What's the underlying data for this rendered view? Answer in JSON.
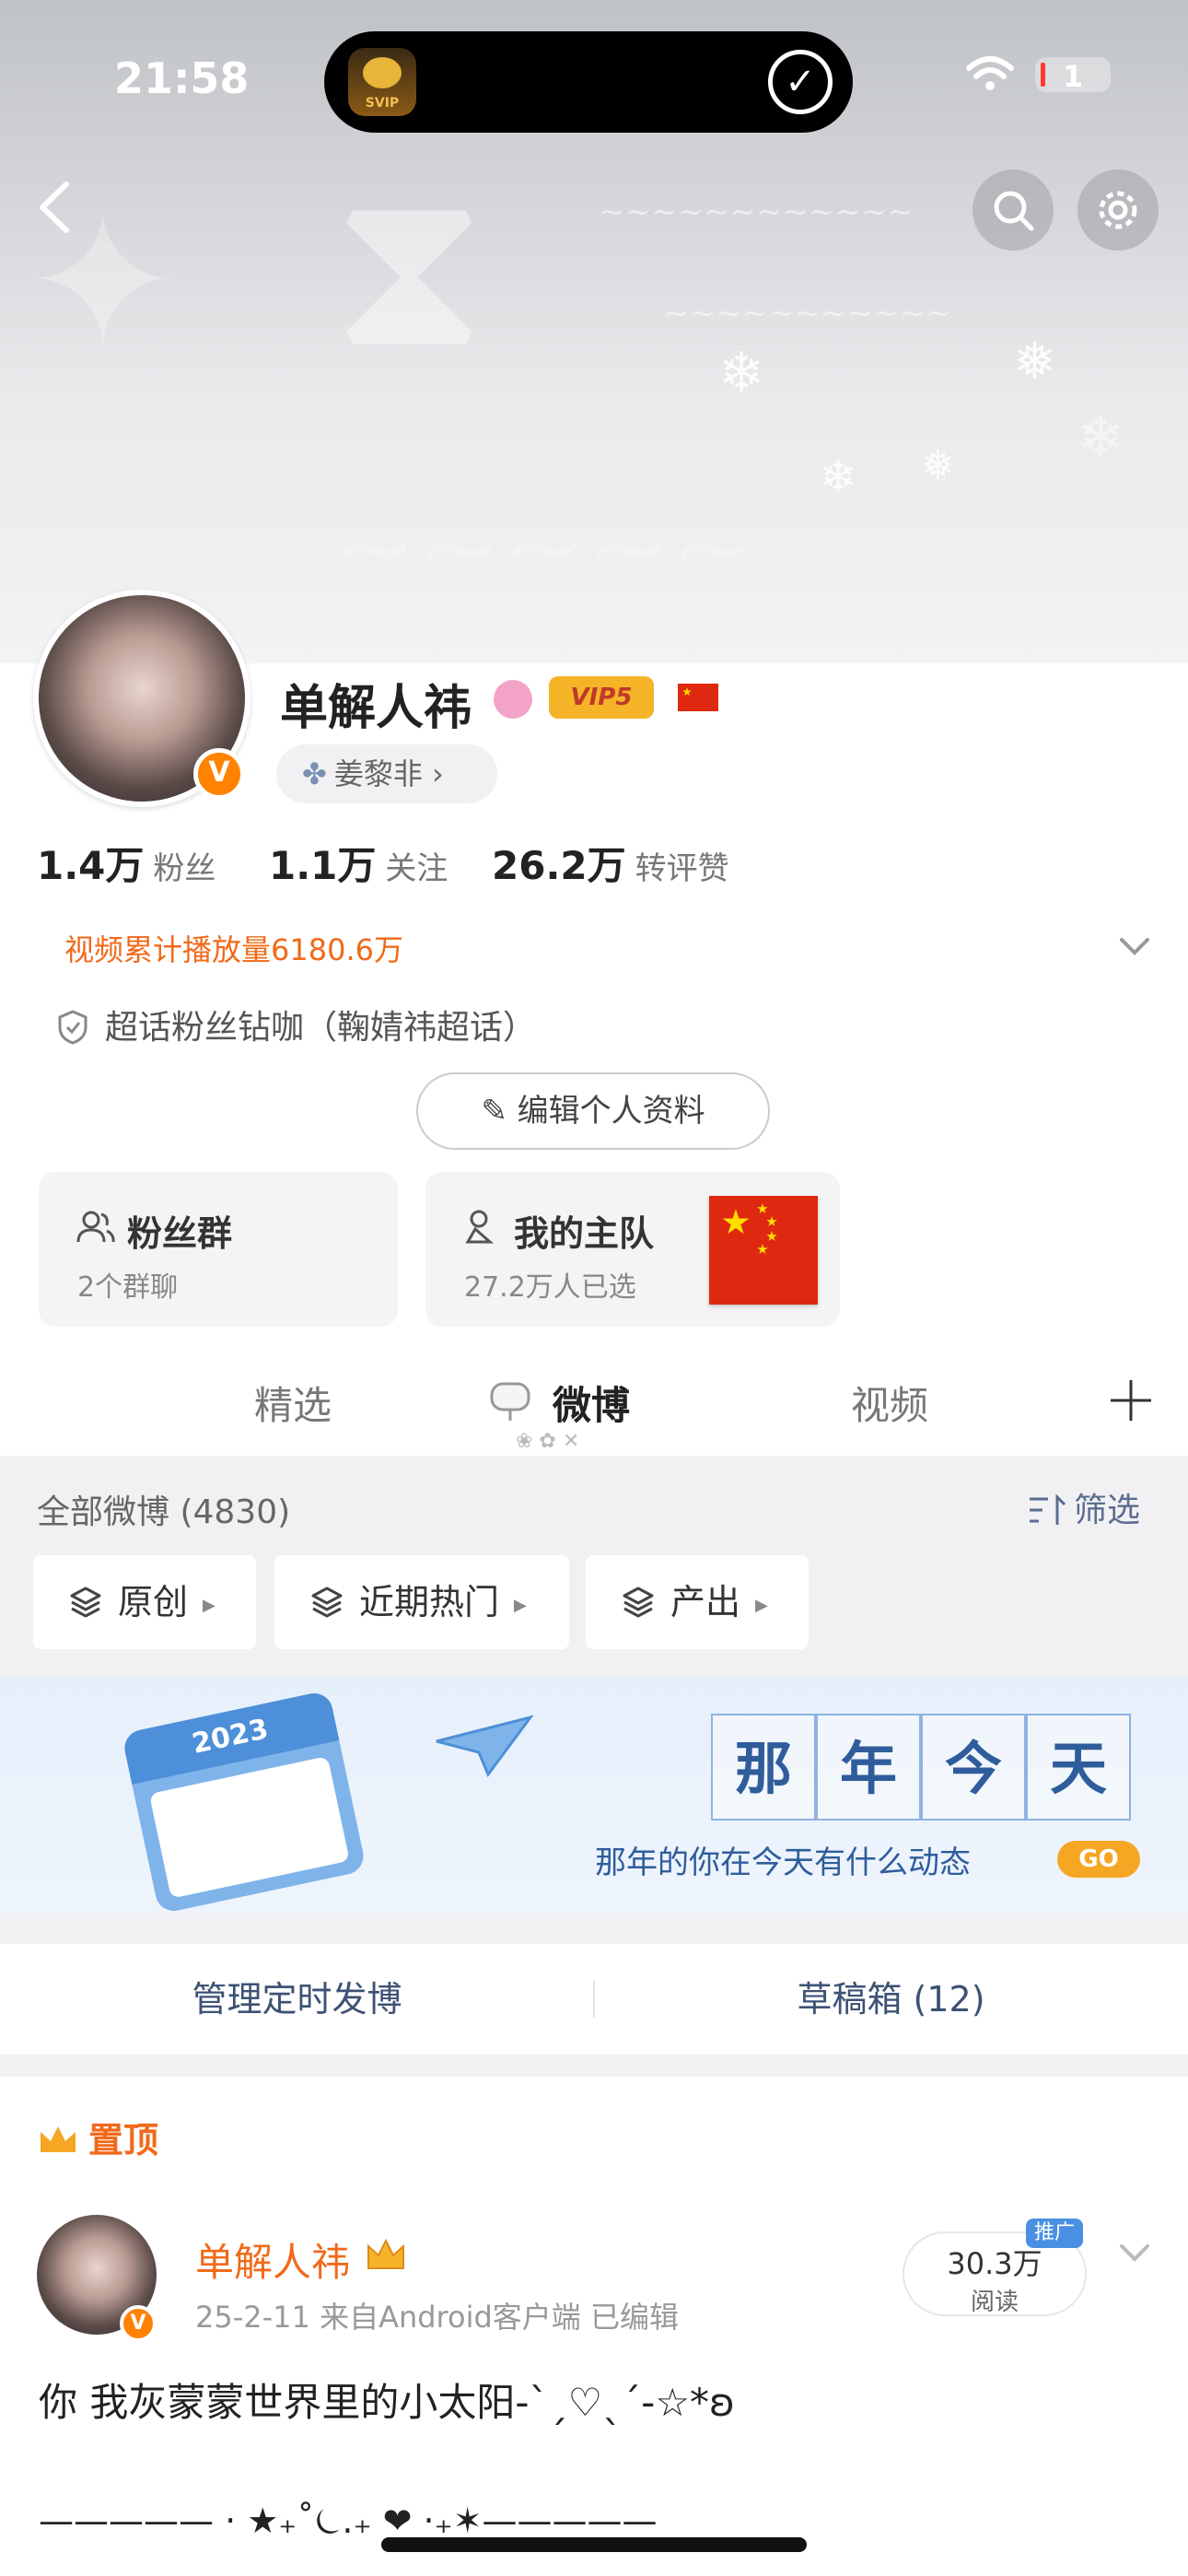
{
  "status_bar": {
    "time": "21:58",
    "battery": "1"
  },
  "island": {
    "app_label": "SVIP"
  },
  "profile": {
    "name": "单解人祎",
    "vip": "VIP5",
    "group_tag": "姜黎非",
    "stats": [
      {
        "value": "1.4万",
        "label": "粉丝"
      },
      {
        "value": "1.1万",
        "label": "关注"
      },
      {
        "value": "26.2万",
        "label": "转评赞"
      }
    ],
    "play_count": "视频累计播放量6180.6万",
    "supertopic": "超话粉丝钻咖（鞠婧祎超话）",
    "edit_button": "编辑个人资料",
    "cards": [
      {
        "title": "粉丝群",
        "sub": "2个群聊"
      },
      {
        "title": "我的主队",
        "sub": "27.2万人已选"
      }
    ]
  },
  "tabs": [
    "精选",
    "微博",
    "视频"
  ],
  "feed": {
    "all_count": "全部微博 (4830)",
    "filter_label": "筛选",
    "chips": [
      "原创",
      "近期热门",
      "产出"
    ],
    "banner": {
      "chars": [
        "那",
        "年",
        "今",
        "天"
      ],
      "tagline": "那年的你在今天有什么动态",
      "go": "GO",
      "calendar_year": "2023"
    },
    "actions": [
      "管理定时发博",
      "草稿箱 (12)"
    ]
  },
  "post": {
    "pinned": "置顶",
    "author": "单解人祎",
    "meta": "25-2-11  来自Android客户端  已编辑",
    "reads_num": "30.3万",
    "reads_label": "阅读",
    "promo": "推广",
    "text": "你 我灰蒙蒙世界里的小太阳-ˋˏ♡ˎˊ-☆*ʚ",
    "divider": "————— · ★₊˚⏾.₊ ❤ ·₊✶—————"
  },
  "colors": {
    "accent": "#f06a1a",
    "link_blue": "#3d5274",
    "vip_gold": "#f5b428",
    "verified": "#ff8200"
  }
}
